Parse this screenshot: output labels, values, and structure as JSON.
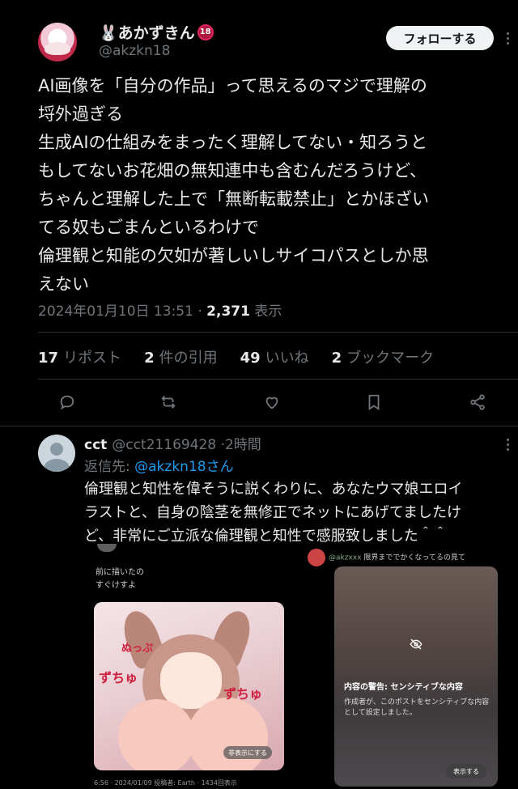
{
  "author": {
    "display_name": "🐰あかずきん",
    "badge": "18",
    "handle": "@akzkn18"
  },
  "follow_label": "フォローする",
  "tweet": {
    "lines": [
      "AI画像を「自分の作品」って思えるのマジで理解の",
      "埒外過ぎる",
      "生成AIの仕組みをまったく理解してない・知ろうと",
      "もしてないお花畑の無知連中も含むんだろうけど、",
      "ちゃんと理解した上で「無断転載禁止」とかほざい",
      "てる奴もごまんといるわけで",
      "倫理観と知能の欠如が著しいしサイコパスとしか思",
      "えない"
    ],
    "timestamp": "2024年01月10日 13:51",
    "separator": "·",
    "views_count": "2,371",
    "views_label": "表示"
  },
  "stats": [
    {
      "count": "17",
      "label": "リポスト"
    },
    {
      "count": "2",
      "label": "件の引用"
    },
    {
      "count": "49",
      "label": "いいね"
    },
    {
      "count": "2",
      "label": "ブックマーク"
    }
  ],
  "actions": [
    {
      "icon": "reply-icon"
    },
    {
      "icon": "retweet-icon"
    },
    {
      "icon": "like-icon"
    },
    {
      "icon": "bookmark-icon"
    },
    {
      "icon": "share-icon"
    }
  ],
  "reply": {
    "display_name": "cct",
    "handle": "@cct21169428",
    "separator": "·",
    "time": "2時間",
    "reply_to_prefix": "返信先: ",
    "reply_to_mention": "@akzkn18さん",
    "lines": [
      "倫理観と知性を偉そうに説くわりに、あなたウマ娘エロイ",
      "ラストと、自身の陰茎を無修正でネットにあげてましたけ",
      "ど、非常にご立派な倫理観と知性で感服致しました＾＾"
    ],
    "embedded_image": {
      "left_post_lines": [
        "前に描いたの",
        "すぐけすよ"
      ],
      "art_sfx": [
        "ずちゅ",
        "ずちゅ",
        "ぬっぷ"
      ],
      "hide_label": "非表示にする",
      "left_footer": "6:56 · 2024/01/09 投稿者: Earth · 1434回表示",
      "right_handle": "@akzxxx",
      "right_text": "限界まででかくなってるの見て",
      "warning_title": "内容の警告: センシティブな内容",
      "warning_body": [
        "作成者が、このポストをセンシティブな内容",
        "として設定しました。"
      ],
      "show_label": "表示する"
    }
  }
}
